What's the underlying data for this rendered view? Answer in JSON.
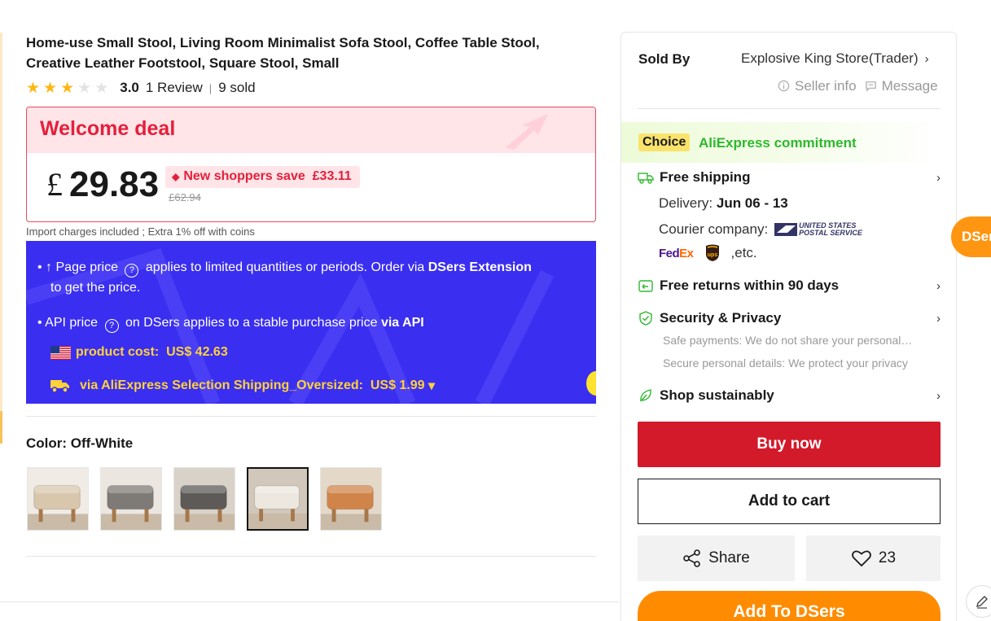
{
  "product": {
    "title": "Home-use Small Stool, Living Room Minimalist Sofa Stool, Coffee Table Stool, Creative Leather Footstool, Square Stool, Small",
    "rating": 3,
    "rating_score": "3.0",
    "reviews": "1 Review",
    "separator": "|",
    "sold": "9 sold"
  },
  "deal": {
    "title": "Welcome deal",
    "currency": "£",
    "price": "29.83",
    "save_label": "New shoppers save",
    "save_amount": "£33.11",
    "old_price": "£62.94",
    "import_note": "Import charges included ; Extra 1% off with coins"
  },
  "dsers_panel": {
    "line1_prefix": "• ↑ Page price",
    "line1_mid": "applies to limited quantities or periods. Order via",
    "line1_bold": "DSers Extension",
    "line1_end": "to get the price.",
    "line2_prefix": "• API price",
    "line2_mid": "on DSers applies to a stable purchase price",
    "line2_bold": "via API",
    "product_cost_label": "product cost:",
    "product_cost_value": "US$ 42.63",
    "shipping_label": "via AliExpress Selection Shipping_Oversized:",
    "shipping_value": "US$ 1.99",
    "shipping_caret": "▾",
    "qmark": "?"
  },
  "color": {
    "label": "Color: Off-White",
    "options": [
      {
        "name": "Beige",
        "tone": "#d8c7ad",
        "bg": "#f0ebe4",
        "selected": false
      },
      {
        "name": "Grey",
        "tone": "#7e7a76",
        "bg": "#ebe6e0",
        "selected": false
      },
      {
        "name": "Dark Grey",
        "tone": "#5d5a57",
        "bg": "#d9d2c8",
        "selected": false
      },
      {
        "name": "Off-White",
        "tone": "#ece7df",
        "bg": "#d1c7ba",
        "selected": true
      },
      {
        "name": "Orange",
        "tone": "#d1844a",
        "bg": "#e4d8c9",
        "selected": false
      }
    ]
  },
  "sidebar": {
    "sold_by_label": "Sold By",
    "store_name": "Explosive King Store(Trader)",
    "seller_info": "Seller info",
    "message": "Message",
    "choice_tag": "Choice",
    "commitment": "AliExpress commitment",
    "free_shipping": "Free shipping",
    "delivery_label": "Delivery:",
    "delivery_dates": "Jun 06 - 13",
    "courier_label": "Courier company:",
    "usps_line1": "UNITED STATES",
    "usps_line2": "POSTAL SERVICE",
    "fedex_fed": "Fed",
    "fedex_ex": "Ex",
    "etc": ",etc.",
    "free_returns": "Free returns within 90 days",
    "security": "Security & Privacy",
    "safe_payments": "Safe payments: We do not share your personal details with any third party",
    "secure_details": "Secure personal details: We protect your privacy",
    "sustainable": "Shop sustainably",
    "buy_now": "Buy now",
    "add_to_cart": "Add to cart",
    "share": "Share",
    "wishlist_count": "23",
    "add_to_dsers": "Add To DSers"
  },
  "floating": {
    "dsers_tab": "DSers"
  },
  "colors": {
    "brand_red": "#d21a2b",
    "deal_red": "#e3203b",
    "dsers_blue": "#3a2ef0",
    "dsers_orange": "#ff8c00",
    "star_gold": "#fdb714",
    "choice_green": "#2eb82e"
  }
}
